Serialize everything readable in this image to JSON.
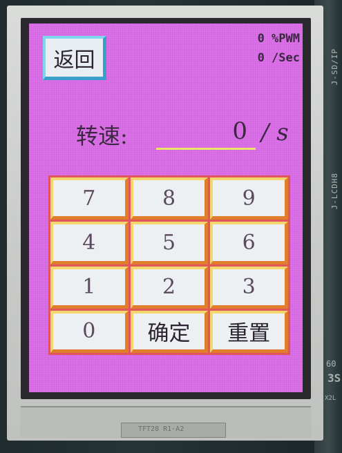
{
  "device": {
    "silkscreen_right_top": "J-SD/IP",
    "silkscreen_right_mid": "J-LCDH8",
    "silkscreen_corner": "3S",
    "silkscreen_corner_2": "60",
    "silkscreen_corner_3": "X2L",
    "fpc_label": "TFT28 R1-A2"
  },
  "header": {
    "back_label": "返回",
    "pwm_status": "0 %PWM",
    "sec_status": "0 /Sec"
  },
  "speed": {
    "label": "转速:",
    "value": "0",
    "unit": "/ s"
  },
  "keypad": {
    "keys": [
      "7",
      "8",
      "9",
      "4",
      "5",
      "6",
      "1",
      "2",
      "3",
      "0",
      "确定",
      "重置"
    ]
  },
  "colors": {
    "screen_bg": "#d96ce6",
    "back_button_border": "#3a9fcb",
    "key_border_light": "#f3d76e",
    "key_border_dark": "#e07e2c",
    "keypad_frame": "#e0565a",
    "input_underline": "#e8e56a"
  }
}
